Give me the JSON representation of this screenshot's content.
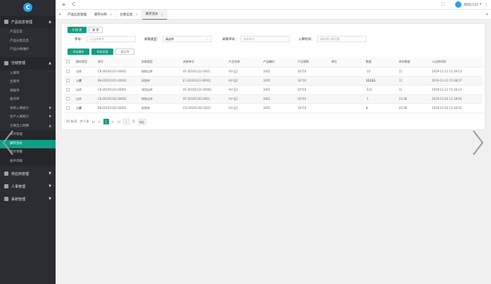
{
  "sidebar": {
    "logo": "C",
    "groups": [
      {
        "label": "产品信息管理",
        "items": [
          "产品信息",
          "产品分类信息",
          "产品价格维护"
        ]
      },
      {
        "label": "仓储管理",
        "items": [
          "入库单",
          "出库单",
          "调拨单",
          "盘点单",
          "采购入库统计",
          "生产入库统计",
          "仓库出入明细"
        ],
        "sub": [
          "库存管理",
          "库存流水",
          "库存预警",
          "备件调拨"
        ]
      },
      {
        "label": "供应商管理"
      },
      {
        "label": "人事管理"
      },
      {
        "label": "系统管理"
      }
    ]
  },
  "topbar": {
    "menu_icon": "≡",
    "refresh_icon": "C",
    "fullscreen_icon": "⛶",
    "user_name": "测试1121",
    "user_caret": "▾",
    "more_icon": "⋮"
  },
  "tabs": {
    "left_arrow": "«",
    "right_arrow": "»",
    "close_glyph": "×",
    "items": [
      "产品信息管理",
      "库存分布",
      "仓库信息",
      "库存流水"
    ],
    "right_ctl": "»"
  },
  "toolbar": {
    "search": "Q 搜 索",
    "reset": "重 置",
    "import": "导出操作",
    "export": "导出全部",
    "columns": "显示列"
  },
  "filters": {
    "order_no_label": "单号：",
    "order_no_placeholder": "入/出库单号",
    "related_type_label": "关联类型：",
    "related_type_value": "请选择",
    "related_no_label": "关联单号：",
    "related_no_placeholder": "关联单号",
    "time_label": "入库时间：",
    "time_placeholder": "请选择日期范围"
  },
  "table": {
    "headers": [
      "操作类型",
      "单号",
      "关联类型",
      "关联单号",
      "产品名称",
      "产品编码",
      "产品规格",
      "单位",
      "数量",
      "库存数量",
      "入出库时间"
    ],
    "rows": [
      [
        "出库",
        "CK-20191121-00001",
        "销售出库",
        "XF-20191121-0001",
        "A产品1",
        "1001",
        "10*10",
        "",
        "-10",
        "11",
        "2019-11-21 15:39:13"
      ],
      [
        "入库",
        "RK-20191121-00002",
        "采购单",
        "JC-20191121-00001",
        "A产品1",
        "1001",
        "10*10",
        "",
        "11111",
        "11",
        "2019-11-21 15:38:57"
      ],
      [
        "出库",
        "CK-20191121-00001",
        "领用出库",
        "XF-20191121-00001",
        "A产品1",
        "1001",
        "10*10",
        "",
        "-111",
        "11",
        "2019-11-21 15:38:14"
      ],
      [
        "出库",
        "CK-20191102-00001",
        "销售出库",
        "XF-20191102-0001",
        "A产品1",
        "1001",
        "10*10",
        "",
        "-1",
        "24.38",
        "2019-11-02 11:18:04"
      ],
      [
        "入库",
        "RK-20191102-00001",
        "采购单",
        "CG-20191102-0001",
        "A产品1",
        "1001",
        "10*10",
        "",
        "1",
        "24.38",
        "2019-11-02 11:16:01"
      ]
    ]
  },
  "pager": {
    "page_size": "10 条/页",
    "total": "共 5 条",
    "first": "|<",
    "prev": "<",
    "current": "1",
    "next": ">",
    "last": ">|",
    "goto_value": "1",
    "page_unit": "页",
    "confirm": "确定"
  },
  "overlay": {
    "left_arrow": "prev-arrow",
    "right_arrow": "next-arrow"
  }
}
